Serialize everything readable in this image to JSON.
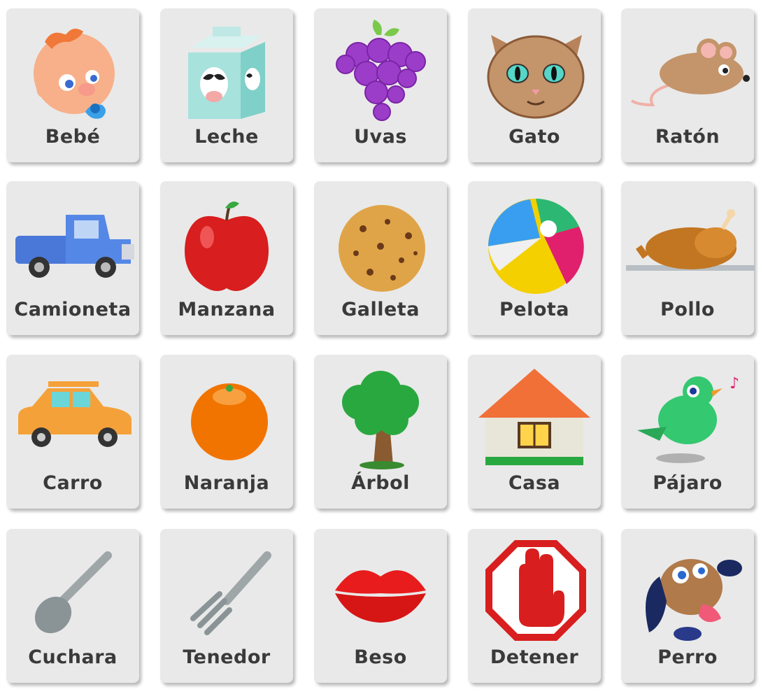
{
  "cards": [
    {
      "label": "Bebé",
      "icon": "baby-icon"
    },
    {
      "label": "Leche",
      "icon": "milk-carton-icon"
    },
    {
      "label": "Uvas",
      "icon": "grapes-icon"
    },
    {
      "label": "Gato",
      "icon": "cat-icon"
    },
    {
      "label": "Ratón",
      "icon": "mouse-icon"
    },
    {
      "label": "Camioneta",
      "icon": "pickup-truck-icon"
    },
    {
      "label": "Manzana",
      "icon": "apple-icon"
    },
    {
      "label": "Galleta",
      "icon": "cookie-icon"
    },
    {
      "label": "Pelota",
      "icon": "beach-ball-icon"
    },
    {
      "label": "Pollo",
      "icon": "roast-chicken-icon"
    },
    {
      "label": "Carro",
      "icon": "car-icon"
    },
    {
      "label": "Naranja",
      "icon": "orange-icon"
    },
    {
      "label": "Árbol",
      "icon": "tree-icon"
    },
    {
      "label": "Casa",
      "icon": "house-icon"
    },
    {
      "label": "Pájaro",
      "icon": "bird-icon"
    },
    {
      "label": "Cuchara",
      "icon": "spoon-icon"
    },
    {
      "label": "Tenedor",
      "icon": "fork-icon"
    },
    {
      "label": "Beso",
      "icon": "kiss-lips-icon"
    },
    {
      "label": "Detener",
      "icon": "stop-sign-icon"
    },
    {
      "label": "Perro",
      "icon": "dog-icon"
    }
  ],
  "colors": {
    "card_bg": "#e9e9e9",
    "label_text": "#3a3a3a",
    "page_bg": "#ffffff"
  }
}
